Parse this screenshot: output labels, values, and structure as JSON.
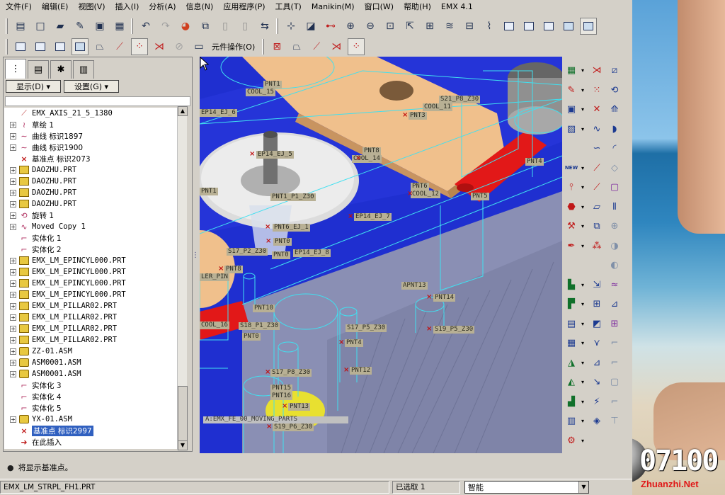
{
  "menu": [
    "文件(F)",
    "编辑(E)",
    "视图(V)",
    "插入(I)",
    "分析(A)",
    "信息(N)",
    "应用程序(P)",
    "工具(T)",
    "Manikin(M)",
    "窗口(W)",
    "帮助(H)",
    "EMX 4.1"
  ],
  "toolbar2": {
    "component_ops_label": "元件操作(O)"
  },
  "left_panel": {
    "show_label": "显示(D) ▾",
    "settings_label": "设置(G) ▾",
    "tree": [
      {
        "label": "EMX_AXIS_21_5_1380",
        "icon": "axis-icon",
        "expandable": false
      },
      {
        "label": "草绘 1",
        "icon": "sketch-icon",
        "expandable": true
      },
      {
        "label": "曲线 标识1897",
        "icon": "curve-icon",
        "expandable": true
      },
      {
        "label": "曲线 标识1900",
        "icon": "curve-icon",
        "expandable": true
      },
      {
        "label": "基准点 标识2073",
        "icon": "datum-point-icon",
        "expandable": false
      },
      {
        "label": "DAOZHU.PRT",
        "icon": "part-icon",
        "expandable": true
      },
      {
        "label": "DAOZHU.PRT",
        "icon": "part-icon",
        "expandable": true
      },
      {
        "label": "DAOZHU.PRT",
        "icon": "part-icon",
        "expandable": true
      },
      {
        "label": "DAOZHU.PRT",
        "icon": "part-icon",
        "expandable": true
      },
      {
        "label": "旋转 1",
        "icon": "revolve-icon",
        "expandable": true
      },
      {
        "label": "Moved Copy 1",
        "icon": "copy-icon",
        "expandable": true
      },
      {
        "label": "实体化 1",
        "icon": "solidify-icon",
        "expandable": false
      },
      {
        "label": "实体化 2",
        "icon": "solidify-icon",
        "expandable": false
      },
      {
        "label": "EMX_LM_EPINCYL000.PRT",
        "icon": "part-icon",
        "expandable": true
      },
      {
        "label": "EMX_LM_EPINCYL000.PRT",
        "icon": "part-icon",
        "expandable": true
      },
      {
        "label": "EMX_LM_EPINCYL000.PRT",
        "icon": "part-icon",
        "expandable": true
      },
      {
        "label": "EMX_LM_EPINCYL000.PRT",
        "icon": "part-icon",
        "expandable": true
      },
      {
        "label": "EMX_LM_PILLAR02.PRT",
        "icon": "part-icon",
        "expandable": true
      },
      {
        "label": "EMX_LM_PILLAR02.PRT",
        "icon": "part-icon",
        "expandable": true
      },
      {
        "label": "EMX_LM_PILLAR02.PRT",
        "icon": "part-icon",
        "expandable": true
      },
      {
        "label": "EMX_LM_PILLAR02.PRT",
        "icon": "part-icon",
        "expandable": true
      },
      {
        "label": "ZZ-01.ASM",
        "icon": "assembly-icon",
        "expandable": true
      },
      {
        "label": "ASM0001.ASM",
        "icon": "assembly-icon",
        "expandable": true
      },
      {
        "label": "ASM0001.ASM",
        "icon": "assembly-icon",
        "expandable": true
      },
      {
        "label": "实体化 3",
        "icon": "solidify-icon",
        "expandable": false
      },
      {
        "label": "实体化 4",
        "icon": "solidify-icon",
        "expandable": false
      },
      {
        "label": "实体化 5",
        "icon": "solidify-icon",
        "expandable": false
      },
      {
        "label": "YX-01.ASM",
        "icon": "assembly-icon",
        "expandable": true
      },
      {
        "label": "基准点 标识2997",
        "icon": "datum-point-icon",
        "expandable": false,
        "selected": true
      },
      {
        "label": "在此插入",
        "icon": "insert-here-icon",
        "expandable": false
      }
    ]
  },
  "graphics": {
    "labels": [
      "PNT1",
      "COOL_15",
      "S21_P8_Z30",
      "COOL_11",
      "PNT3",
      "EP14_EJ_6",
      "EP14_EJ_5",
      "PNT8",
      "COOL_14",
      "PNT4",
      "PNT6",
      "COOL_12",
      "PNT1_P1_Z30",
      "PNT5",
      "EP14_EJ_7",
      "PNT6_EJ_1",
      "PNT0",
      "PNT1",
      "S17_P2_Z30",
      "EP14_EJ_8",
      "PNT0",
      "PNT8",
      "LER_PIN",
      "APNT13",
      "PNT14",
      "PNT10",
      "COOL_16",
      "S18_P1_Z30",
      "S17_P5_Z30",
      "S19_P5_Z30",
      "PNT0",
      "PNT4",
      "S17_P8_Z30",
      "PNT12",
      "PNT15",
      "PNT16",
      "PNT13",
      "S19_P6_Z30",
      "A:EMX_FE_00_MOVING_PARTS"
    ]
  },
  "message": "将显示基准点。",
  "status": {
    "file": "EMX_LM_STRPL_FH1.PRT",
    "selected": "已选取 1",
    "filter": "智能"
  },
  "watermark": {
    "number": "07100",
    "site": "Zhuanzhi.Net"
  }
}
